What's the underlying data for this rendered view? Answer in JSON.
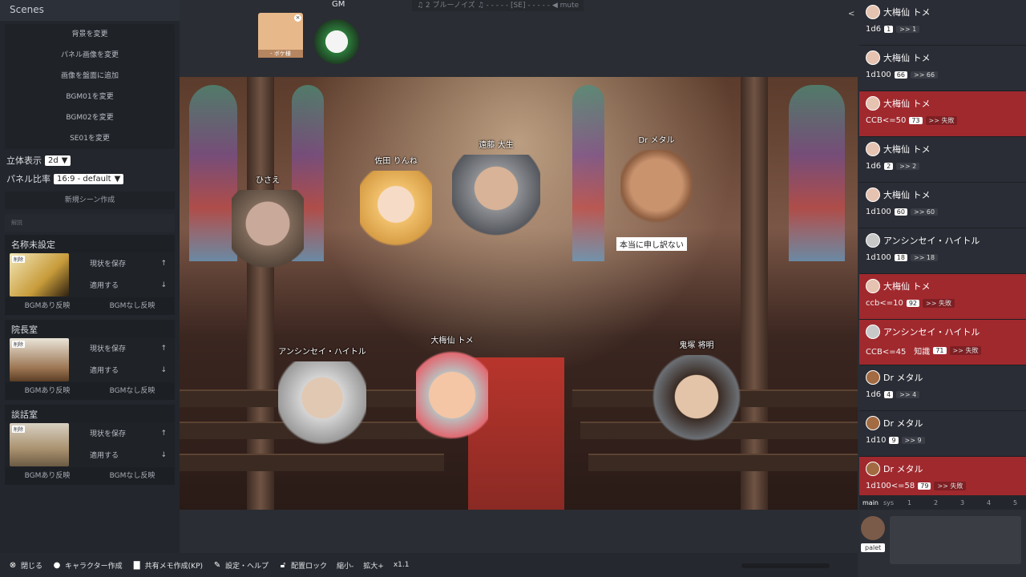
{
  "sidebar": {
    "header": "Scenes",
    "actions": [
      "背景を変更",
      "パネル画像を変更",
      "画像を盤面に追加",
      "BGM01を変更",
      "BGM02を変更",
      "SE01を変更"
    ],
    "stereo_label": "立体表示",
    "stereo_value": "2d",
    "ratio_label": "パネル比率",
    "ratio_value": "16:9 - default",
    "new_scene": "新規シーン作成",
    "separator": "解説",
    "scenes": [
      {
        "title": "名称未設定",
        "tag": "削除",
        "save": "現状を保存",
        "apply": "適用する",
        "bgm_on": "BGMあり反映",
        "bgm_off": "BGMなし反映",
        "color": "#e9d48a"
      },
      {
        "title": "院長室",
        "tag": "削除",
        "save": "現状を保存",
        "apply": "適用する",
        "bgm_on": "BGMあり反映",
        "bgm_off": "BGMなし反映",
        "color": "#9b7451"
      },
      {
        "title": "談話室",
        "tag": "削除",
        "save": "現状を保存",
        "apply": "適用する",
        "bgm_on": "BGMあり反映",
        "bgm_off": "BGMなし反映",
        "color": "#a9916e"
      }
    ]
  },
  "top": {
    "gm_label": "GM",
    "bgm_status": "♫ 2 ブルーノイズ ♫ - - - - - [SE] - - - - - ◀ mute",
    "token1_caption": "- ボケ様"
  },
  "stage": {
    "characters": [
      {
        "name": "ひさえ",
        "color": "#b08e7e"
      },
      {
        "name": "佐田 りんね",
        "color": "#f1c06b"
      },
      {
        "name": "遠藤 大生",
        "color": "#8d8f93"
      },
      {
        "name": "Dr メタル",
        "color": "#c9936e"
      },
      {
        "name": "アンシンセイ・ハイトル",
        "color": "#d4d4d4"
      },
      {
        "name": "大梅仙 トメ",
        "color": "#e6b69a"
      },
      {
        "name": "鬼塚 将明",
        "color": "#e3c4a8"
      }
    ],
    "speech": "本当に申し訳ない"
  },
  "toolbar": {
    "close": "閉じる",
    "make_char": "キャラクター作成",
    "memo": "共有メモ作成(KP)",
    "settings": "設定・ヘルプ",
    "lock": "配置ロック",
    "shrink": "縮小-",
    "zoom_in": "拡大+",
    "zoom": "x1.1"
  },
  "log": {
    "collapse": "<",
    "entries": [
      {
        "name": "大梅仙 トメ",
        "cmd": "1d6",
        "result": "1",
        "arrow": ">> 1",
        "fail": false,
        "av": "f"
      },
      {
        "name": "大梅仙 トメ",
        "cmd": "1d100",
        "result": "66",
        "arrow": ">> 66",
        "fail": false,
        "av": "f"
      },
      {
        "name": "大梅仙 トメ",
        "cmd": "CCB<=50",
        "result": "73",
        "arrow": ">> 失敗",
        "fail": true,
        "av": "f"
      },
      {
        "name": "大梅仙 トメ",
        "cmd": "1d6",
        "result": "2",
        "arrow": ">> 2",
        "fail": false,
        "av": "f"
      },
      {
        "name": "大梅仙 トメ",
        "cmd": "1d100",
        "result": "60",
        "arrow": ">> 60",
        "fail": false,
        "av": "f"
      },
      {
        "name": "アンシンセイ・ハイトル",
        "cmd": "1d100",
        "result": "18",
        "arrow": ">> 18",
        "fail": false,
        "av": "m"
      },
      {
        "name": "大梅仙 トメ",
        "cmd": "ccb<=10",
        "result": "92",
        "arrow": ">> 失敗",
        "fail": true,
        "av": "f"
      },
      {
        "name": "アンシンセイ・ハイトル",
        "cmd": "CCB<=45　知識",
        "result": "71",
        "arrow": ">> 失敗",
        "fail": true,
        "av": "m"
      },
      {
        "name": "Dr メタル",
        "cmd": "1d6",
        "result": "4",
        "arrow": ">> 4",
        "fail": false,
        "av": "d"
      },
      {
        "name": "Dr メタル",
        "cmd": "1d10",
        "result": "9",
        "arrow": ">> 9",
        "fail": false,
        "av": "d"
      },
      {
        "name": "Dr メタル",
        "cmd": "1d100<=58",
        "result": "79",
        "arrow": ">> 失敗",
        "fail": true,
        "av": "d"
      }
    ],
    "tabs": [
      "main",
      "sys",
      "1",
      "2",
      "3",
      "4",
      "5"
    ],
    "palet": "palet"
  }
}
